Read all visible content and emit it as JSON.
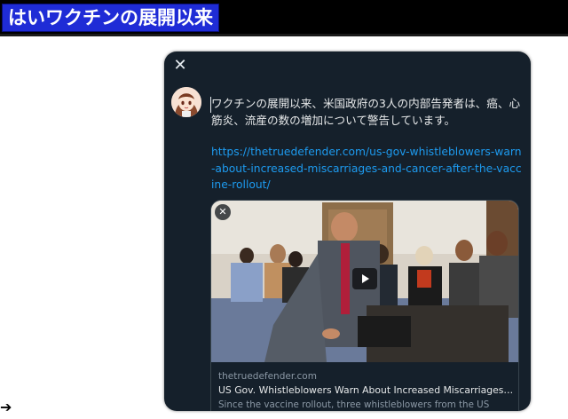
{
  "banner": {
    "title": "はいワクチンの展開以来"
  },
  "modal": {
    "close_icon": "✕",
    "tweet_text": "ワクチンの展開以来、米国政府の3人の内部告発者は、癌、心筋炎、流産の数の増加について警告しています。",
    "tweet_link": "https://thetruedefender.com/us-gov-whistleblowers-warn-about-increased-miscarriages-and-cancer-after-the-vaccine-rollout/",
    "card": {
      "remove_icon": "✕",
      "domain": "thetruedefender.com",
      "title": "US Gov. Whistleblowers Warn About Increased Miscarriages And Ca...",
      "description": "Since the vaccine rollout, three whistleblowers from the US"
    }
  },
  "colors": {
    "banner_bg": "#1f2cd6",
    "modal_bg": "#15202b",
    "link": "#1d9bf0"
  }
}
